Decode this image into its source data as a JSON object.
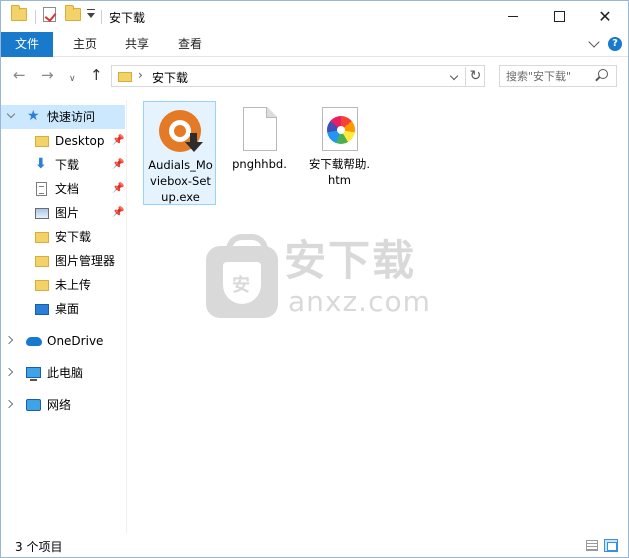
{
  "window": {
    "title": "安下载",
    "controls": {
      "minimize": "minimize",
      "maximize": "maximize",
      "close": "✕"
    }
  },
  "ribbon": {
    "tabs": [
      {
        "label": "文件",
        "active": true
      },
      {
        "label": "主页",
        "active": false
      },
      {
        "label": "共享",
        "active": false
      },
      {
        "label": "查看",
        "active": false
      }
    ],
    "help": "?"
  },
  "nav": {
    "back": "←",
    "forward": "→",
    "recent": "∨",
    "up": "↑",
    "address": {
      "separator": "›",
      "path": "安下载"
    },
    "refresh": "↻",
    "search": {
      "placeholder": "搜索\"安下载\""
    }
  },
  "sidebar": {
    "items": [
      {
        "label": "快速访问",
        "icon": "star-icon",
        "chevron": "down"
      },
      {
        "label": "Desktop",
        "icon": "folder-icon",
        "pinned": true
      },
      {
        "label": "下载",
        "icon": "download-icon",
        "pinned": true
      },
      {
        "label": "文档",
        "icon": "document-icon",
        "pinned": true
      },
      {
        "label": "图片",
        "icon": "pictures-icon",
        "pinned": true
      },
      {
        "label": "安下载",
        "icon": "folder-icon"
      },
      {
        "label": "图片管理器",
        "icon": "folder-icon"
      },
      {
        "label": "未上传",
        "icon": "folder-icon"
      },
      {
        "label": "桌面",
        "icon": "desktop-icon"
      },
      {
        "label": "OneDrive",
        "icon": "onedrive-icon",
        "chevron": "right"
      },
      {
        "label": "此电脑",
        "icon": "this-pc-icon",
        "chevron": "right"
      },
      {
        "label": "网络",
        "icon": "network-icon",
        "chevron": "right"
      }
    ]
  },
  "files": [
    {
      "name": "Audials_Moviebox-Setup.exe",
      "icon": "audials-exe-icon",
      "selected": true
    },
    {
      "name": "pnghhbd.",
      "icon": "blank-file-icon",
      "selected": false
    },
    {
      "name": "安下载帮助.htm",
      "icon": "htm-file-icon",
      "selected": false
    }
  ],
  "watermark": {
    "text": "安下载",
    "sub": "anxz.com",
    "badge": "安"
  },
  "status": {
    "item_count": "3 个项目"
  },
  "colors": {
    "accent": "#1979ca",
    "selection": "#cce8ff",
    "folder": "#f4d26a"
  }
}
